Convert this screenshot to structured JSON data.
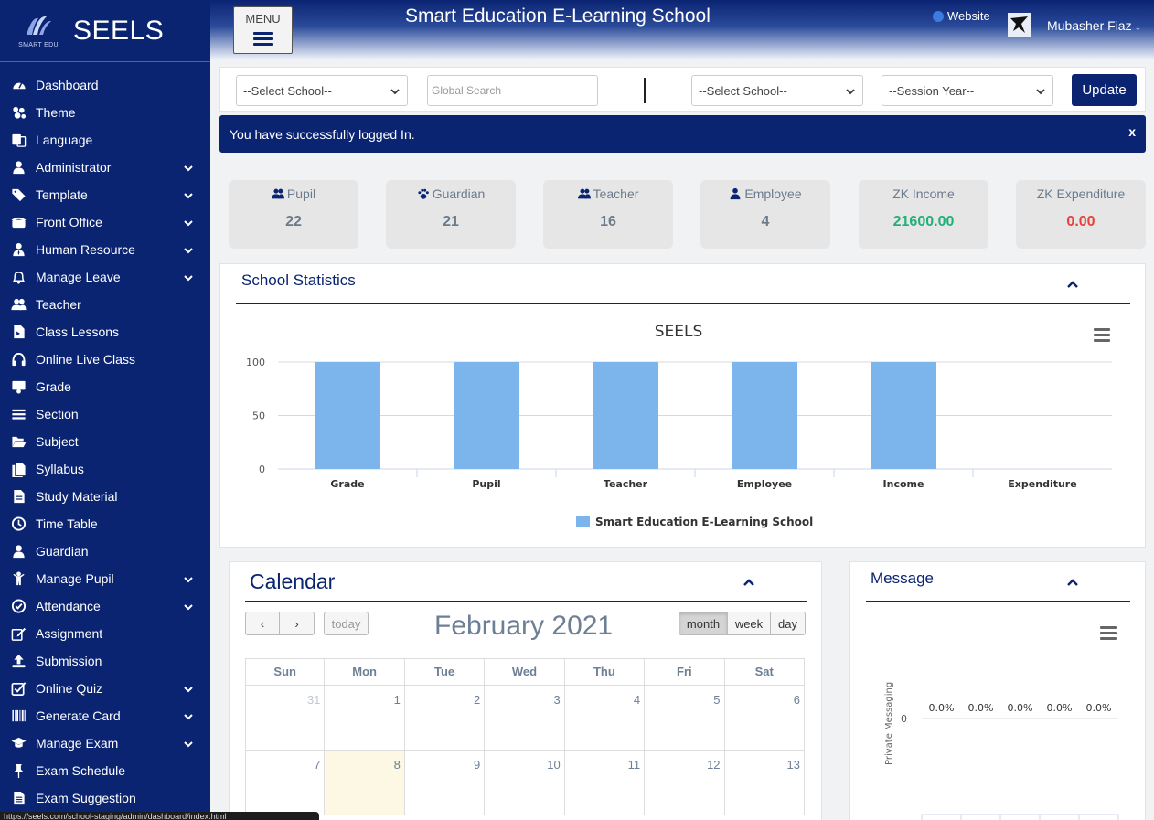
{
  "brand": {
    "name": "SEELS",
    "logo_text": "SMART EDU"
  },
  "sidebar": {
    "items": [
      {
        "label": "Dashboard",
        "icon": "dashboard-icon",
        "expand": false
      },
      {
        "label": "Theme",
        "icon": "theme-icon",
        "expand": false
      },
      {
        "label": "Language",
        "icon": "language-icon",
        "expand": false
      },
      {
        "label": "Administrator",
        "icon": "user-icon",
        "expand": true
      },
      {
        "label": "Template",
        "icon": "tags-icon",
        "expand": true
      },
      {
        "label": "Front Office",
        "icon": "phone-icon",
        "expand": true
      },
      {
        "label": "Human Resource",
        "icon": "user-tie-icon",
        "expand": true
      },
      {
        "label": "Manage Leave",
        "icon": "bell-icon",
        "expand": true
      },
      {
        "label": "Teacher",
        "icon": "users-icon",
        "expand": false
      },
      {
        "label": "Class Lessons",
        "icon": "file-video-icon",
        "expand": false
      },
      {
        "label": "Online Live Class",
        "icon": "headphones-icon",
        "expand": false
      },
      {
        "label": "Grade",
        "icon": "chalkboard-icon",
        "expand": false
      },
      {
        "label": "Section",
        "icon": "list-icon",
        "expand": false
      },
      {
        "label": "Subject",
        "icon": "folder-open-icon",
        "expand": false
      },
      {
        "label": "Syllabus",
        "icon": "files-icon",
        "expand": false
      },
      {
        "label": "Study Material",
        "icon": "file-text-icon",
        "expand": false
      },
      {
        "label": "Time Table",
        "icon": "clock-icon",
        "expand": false
      },
      {
        "label": "Guardian",
        "icon": "user-icon",
        "expand": false
      },
      {
        "label": "Manage Pupil",
        "icon": "child-icon",
        "expand": true
      },
      {
        "label": "Attendance",
        "icon": "check-circle-icon",
        "expand": true
      },
      {
        "label": "Assignment",
        "icon": "edit-icon",
        "expand": false
      },
      {
        "label": "Submission",
        "icon": "upload-icon",
        "expand": false
      },
      {
        "label": "Online Quiz",
        "icon": "check-square-icon",
        "expand": true
      },
      {
        "label": "Generate Card",
        "icon": "barcode-icon",
        "expand": true
      },
      {
        "label": "Manage Exam",
        "icon": "graduation-cap-icon",
        "expand": true
      },
      {
        "label": "Exam Schedule",
        "icon": "thumbtack-icon",
        "expand": false
      },
      {
        "label": "Exam Suggestion",
        "icon": "file-alt-icon",
        "expand": false
      }
    ]
  },
  "header": {
    "menu_label": "MENU",
    "title": "Smart Education E-Learning School",
    "website_label": "Website",
    "user_name": "Mubasher Fiaz"
  },
  "filters": {
    "school_select": "--Select School--",
    "search_placeholder": "Global Search",
    "school_select_2": "--Select School--",
    "session_select": "--Session Year--",
    "update_label": "Update"
  },
  "alert": {
    "message": "You have successfully logged In.",
    "close": "x"
  },
  "stats": [
    {
      "label": "Pupil",
      "value": "22",
      "icon": "users-icon",
      "color": "#6b7b8c"
    },
    {
      "label": "Guardian",
      "value": "21",
      "icon": "paw-icon",
      "color": "#6b7b8c"
    },
    {
      "label": "Teacher",
      "value": "16",
      "icon": "users-icon",
      "color": "#6b7b8c"
    },
    {
      "label": "Employee",
      "value": "4",
      "icon": "user-tie-icon",
      "color": "#6b7b8c"
    },
    {
      "label": "ZK Income",
      "value": "21600.00",
      "icon": "",
      "color": "#21b07a"
    },
    {
      "label": "ZK Expenditure",
      "value": "0.00",
      "icon": "",
      "color": "#e8403a"
    }
  ],
  "school_stats": {
    "title": "School Statistics"
  },
  "chart_data": [
    {
      "type": "bar",
      "title": "SEELS",
      "categories": [
        "Grade",
        "Pupil",
        "Teacher",
        "Employee",
        "Income",
        "Expenditure"
      ],
      "series": [
        {
          "name": "Smart Education E-Learning School",
          "values": [
            100,
            100,
            100,
            100,
            100,
            0
          ],
          "color": "#7cb5ec"
        }
      ],
      "yticks": [
        0,
        50,
        100
      ],
      "ylim": [
        0,
        100
      ],
      "grid": true,
      "legend": "bottom-center"
    },
    {
      "type": "bar",
      "ylabel": "Private Messaging",
      "series": [
        {
          "values": [
            0,
            0,
            0,
            0,
            0
          ],
          "labels": [
            "0.0%",
            "0.0%",
            "0.0%",
            "0.0%",
            "0.0%"
          ]
        }
      ],
      "yticks": [
        0
      ]
    }
  ],
  "calendar": {
    "title": "Calendar",
    "month_label": "February 2021",
    "prev": "‹",
    "next": "›",
    "today_label": "today",
    "views": [
      "month",
      "week",
      "day"
    ],
    "active_view": "month",
    "weekdays": [
      "Sun",
      "Mon",
      "Tue",
      "Wed",
      "Thu",
      "Fri",
      "Sat"
    ],
    "weeks": [
      [
        {
          "d": "31",
          "other": true
        },
        {
          "d": "1"
        },
        {
          "d": "2"
        },
        {
          "d": "3"
        },
        {
          "d": "4"
        },
        {
          "d": "5"
        },
        {
          "d": "6"
        }
      ],
      [
        {
          "d": "7"
        },
        {
          "d": "8",
          "today": true
        },
        {
          "d": "9"
        },
        {
          "d": "10"
        },
        {
          "d": "11"
        },
        {
          "d": "12"
        },
        {
          "d": "13"
        }
      ]
    ]
  },
  "message_panel": {
    "title": "Message"
  },
  "status_url": "https://seels.com/school-staging/admin/dashboard/index.html"
}
